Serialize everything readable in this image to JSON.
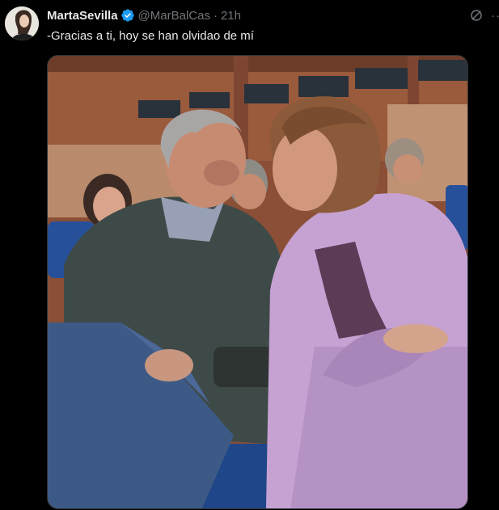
{
  "tweet": {
    "author_name": "MartaSevilla",
    "handle": "@MarBalCas",
    "separator": "·",
    "time": "21h",
    "text": "-Gracias a ti, hoy se han olvidao de mí",
    "more_glyph": "··"
  },
  "icons": {
    "verified": "verified-badge-icon",
    "grok": "grok-icon",
    "more": "more-options-icon"
  },
  "colors": {
    "background": "#000000",
    "primary_text": "#e7e9ea",
    "secondary_text": "#71767b",
    "verified_blue": "#1d9bf0"
  }
}
